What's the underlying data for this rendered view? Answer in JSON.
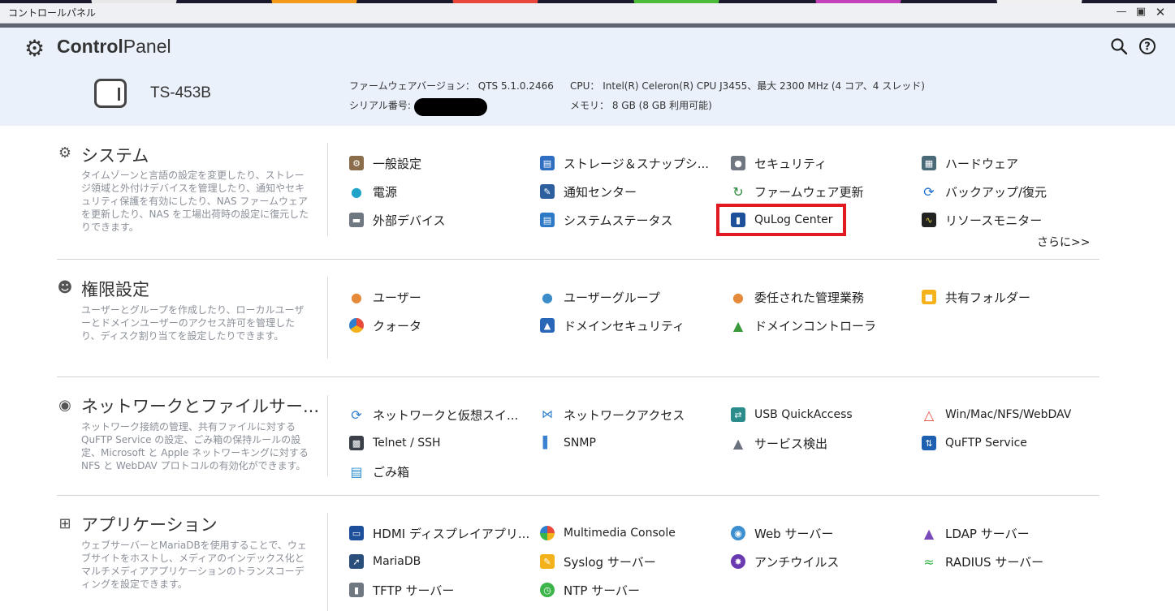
{
  "window": {
    "title": "コントロールパネル",
    "minimize_icon": "minimize-icon",
    "maximize_icon": "maximize-icon",
    "close_icon": "close-icon"
  },
  "header": {
    "app_title_bold": "Control",
    "app_title_rest": "Panel",
    "model": "TS-453B",
    "firmware_label": "ファームウェアバージョン：",
    "firmware_value": "QTS 5.1.0.2466",
    "serial_label": "シリアル番号:",
    "cpu_label": "CPU：",
    "cpu_value": "Intel(R) Celeron(R) CPU J3455、最大 2300 MHz (4 コア、4 スレッド)",
    "memory_label": "メモリ：",
    "memory_value": "8 GB (8 GB 利用可能)"
  },
  "sections": [
    {
      "title": "システム",
      "desc": "タイムゾーンと言語の設定を変更したり、ストレージ領域と外付けデバイスを管理したり、通知やセキュリティ保護を有効にしたり、NAS ファームウェアを更新したり、NAS を工場出荷時の設定に復元したりできます。",
      "items": [
        "一般設定",
        "ストレージ＆スナップシ...",
        "セキュリティ",
        "ハードウェア",
        "電源",
        "通知センター",
        "ファームウェア更新",
        "バックアップ/復元",
        "外部デバイス",
        "システムステータス",
        "QuLog Center",
        "リソースモニター"
      ],
      "more": "さらに>>"
    },
    {
      "title": "権限設定",
      "desc": "ユーザーとグループを作成したり、ローカルユーザーとドメインユーザーのアクセス許可を管理したり、ディスク割り当てを設定したりできます。",
      "items": [
        "ユーザー",
        "ユーザーグループ",
        "委任された管理業務",
        "共有フォルダー",
        "クォータ",
        "ドメインセキュリティ",
        "ドメインコントローラ"
      ]
    },
    {
      "title": "ネットワークとファイルサー...",
      "desc": "ネットワーク接続の管理、共有ファイルに対するQuFTP Service の設定、ごみ箱の保持ルールの設定、Microsoft と Apple ネットワーキングに対するNFS と WebDAV プロトコルの有効化ができます。",
      "items": [
        "ネットワークと仮想スイ...",
        "ネットワークアクセス",
        "USB QuickAccess",
        "Win/Mac/NFS/WebDAV",
        "Telnet / SSH",
        "SNMP",
        "サービス検出",
        "QuFTP Service",
        "ごみ箱"
      ]
    },
    {
      "title": "アプリケーション",
      "desc": "ウェブサーバーとMariaDBを使用することで、ウェブサイトをホストし、メディアのインデックス化とマルチメディアアプリケーションのトランスコーディングを設定できます。",
      "items": [
        "HDMI ディスプレイアプリ...",
        "Multimedia Console",
        "Web サーバー",
        "LDAP サーバー",
        "MariaDB",
        "Syslog サーバー",
        "アンチウイルス",
        "RADIUS サーバー",
        "TFTP サーバー",
        "NTP サーバー"
      ]
    }
  ],
  "colors": {
    "highlight": "#e11a22",
    "header_bg": "#eaf1fb"
  }
}
